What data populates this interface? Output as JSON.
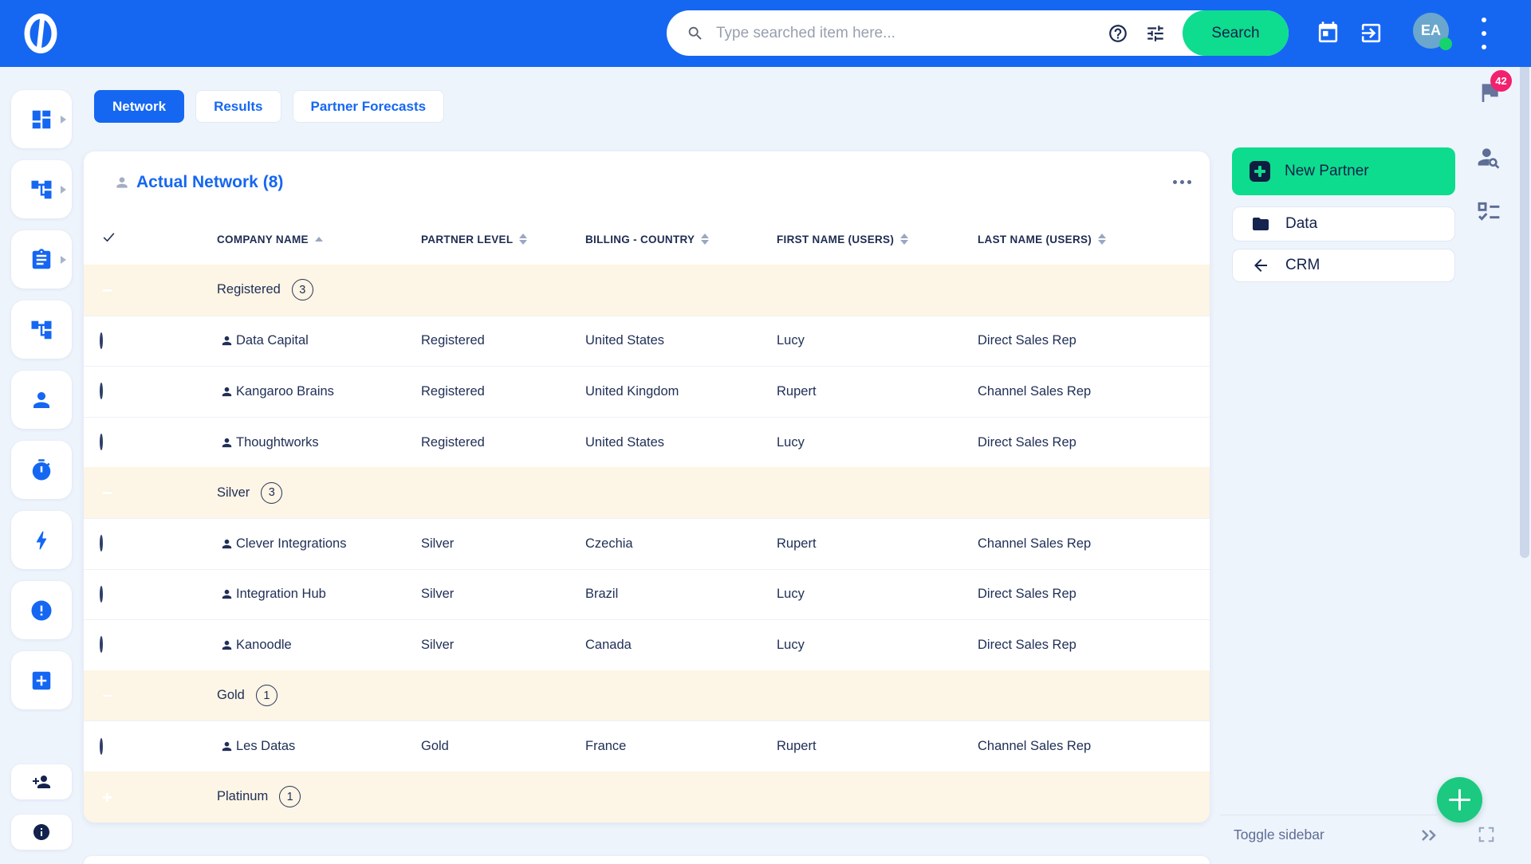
{
  "colors": {
    "header_blue": "#1567f2",
    "accent_green": "#0edc8e",
    "group_row": "#fdf5e5",
    "badge_red": "#f2206e"
  },
  "header": {
    "search_placeholder": "Type searched item here...",
    "search_button": "Search",
    "avatar_initials": "EA"
  },
  "sidebar": {
    "items": [
      {
        "icon": "dashboard",
        "chevron": true
      },
      {
        "icon": "org-tree",
        "chevron": true
      },
      {
        "icon": "clipboard",
        "chevron": true
      },
      {
        "icon": "org-tree",
        "chevron": false
      },
      {
        "icon": "person",
        "chevron": false
      },
      {
        "icon": "timer",
        "chevron": false
      },
      {
        "icon": "bolt",
        "chevron": false
      },
      {
        "icon": "alert",
        "chevron": false
      },
      {
        "icon": "add-box",
        "chevron": false
      }
    ],
    "footer_items": [
      {
        "icon": "person-add"
      },
      {
        "icon": "info"
      }
    ]
  },
  "tabs": [
    {
      "label": "Network",
      "active": true
    },
    {
      "label": "Results",
      "active": false
    },
    {
      "label": "Partner Forecasts",
      "active": false
    }
  ],
  "table": {
    "title": "Actual Network (8)",
    "columns": [
      {
        "label": "COMPANY NAME",
        "sort": "asc"
      },
      {
        "label": "PARTNER LEVEL",
        "sort": "none"
      },
      {
        "label": "BILLING - COUNTRY",
        "sort": "none"
      },
      {
        "label": "FIRST NAME (USERS)",
        "sort": "none"
      },
      {
        "label": "LAST NAME (USERS)",
        "sort": "none"
      }
    ],
    "groups": [
      {
        "label": "Registered",
        "count": "3",
        "expanded": true,
        "rows": [
          {
            "company": "Data Capital",
            "partner_level": "Registered",
            "billing_country": "United States",
            "first_name": "Lucy",
            "last_name": "Direct Sales Rep"
          },
          {
            "company": "Kangaroo Brains",
            "partner_level": "Registered",
            "billing_country": "United Kingdom",
            "first_name": "Rupert",
            "last_name": "Channel Sales Rep"
          },
          {
            "company": "Thoughtworks",
            "partner_level": "Registered",
            "billing_country": "United States",
            "first_name": "Lucy",
            "last_name": "Direct Sales Rep"
          }
        ]
      },
      {
        "label": "Silver",
        "count": "3",
        "expanded": true,
        "rows": [
          {
            "company": "Clever Integrations",
            "partner_level": "Silver",
            "billing_country": "Czechia",
            "first_name": "Rupert",
            "last_name": "Channel Sales Rep"
          },
          {
            "company": "Integration Hub",
            "partner_level": "Silver",
            "billing_country": "Brazil",
            "first_name": "Lucy",
            "last_name": "Direct Sales Rep"
          },
          {
            "company": "Kanoodle",
            "partner_level": "Silver",
            "billing_country": "Canada",
            "first_name": "Lucy",
            "last_name": "Direct Sales Rep"
          }
        ]
      },
      {
        "label": "Gold",
        "count": "1",
        "expanded": true,
        "rows": [
          {
            "company": "Les Datas",
            "partner_level": "Gold",
            "billing_country": "France",
            "first_name": "Rupert",
            "last_name": "Channel Sales Rep"
          }
        ]
      },
      {
        "label": "Platinum",
        "count": "1",
        "expanded": false,
        "rows": []
      }
    ]
  },
  "right_panel": {
    "flag_badge": "42",
    "new_partner": "New Partner",
    "data": "Data",
    "crm": "CRM"
  },
  "footer": {
    "toggle_sidebar": "Toggle sidebar"
  }
}
